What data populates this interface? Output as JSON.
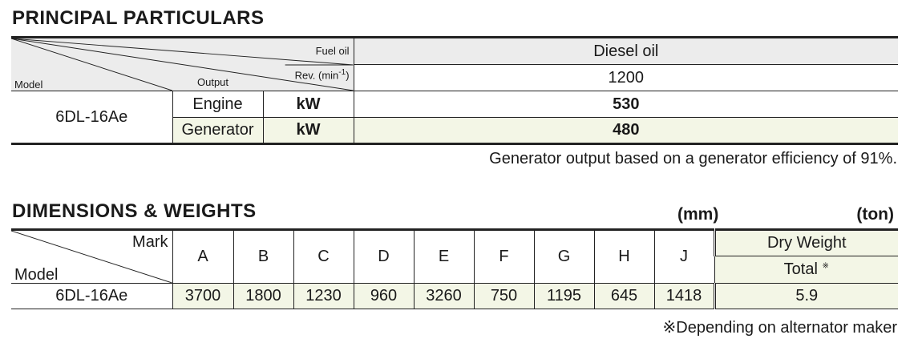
{
  "principal": {
    "title": "PRINCIPAL  PARTICULARS",
    "header": {
      "fuel_oil_label": "Fuel oil",
      "rev_label": "Rev. (min",
      "rev_exp": "-1",
      "rev_close": ")",
      "output_label": "Output",
      "model_label": "Model",
      "fuel_oil_value": "Diesel  oil",
      "rev_value": "1200"
    },
    "model": "6DL-16Ae",
    "rows": [
      {
        "label": "Engine",
        "unit": "kW",
        "value": "530"
      },
      {
        "label": "Generator",
        "unit": "kW",
        "value": "480"
      }
    ],
    "note": "Generator output based on a generator efficiency of 91%."
  },
  "dimensions": {
    "title": "DIMENSIONS  &  WEIGHTS",
    "unit_mm": "(mm)",
    "unit_ton": "(ton)",
    "mark_label": "Mark",
    "model_label": "Model",
    "columns": [
      "A",
      "B",
      "C",
      "D",
      "E",
      "F",
      "G",
      "H",
      "J"
    ],
    "dry_weight_label": "Dry  Weight",
    "total_label": "Total",
    "total_mark": "※",
    "model": "6DL-16Ae",
    "values": [
      "3700",
      "1800",
      "1230",
      "960",
      "3260",
      "750",
      "1195",
      "645",
      "1418"
    ],
    "total_value": "5.9",
    "note": "※Depending on alternator maker"
  }
}
